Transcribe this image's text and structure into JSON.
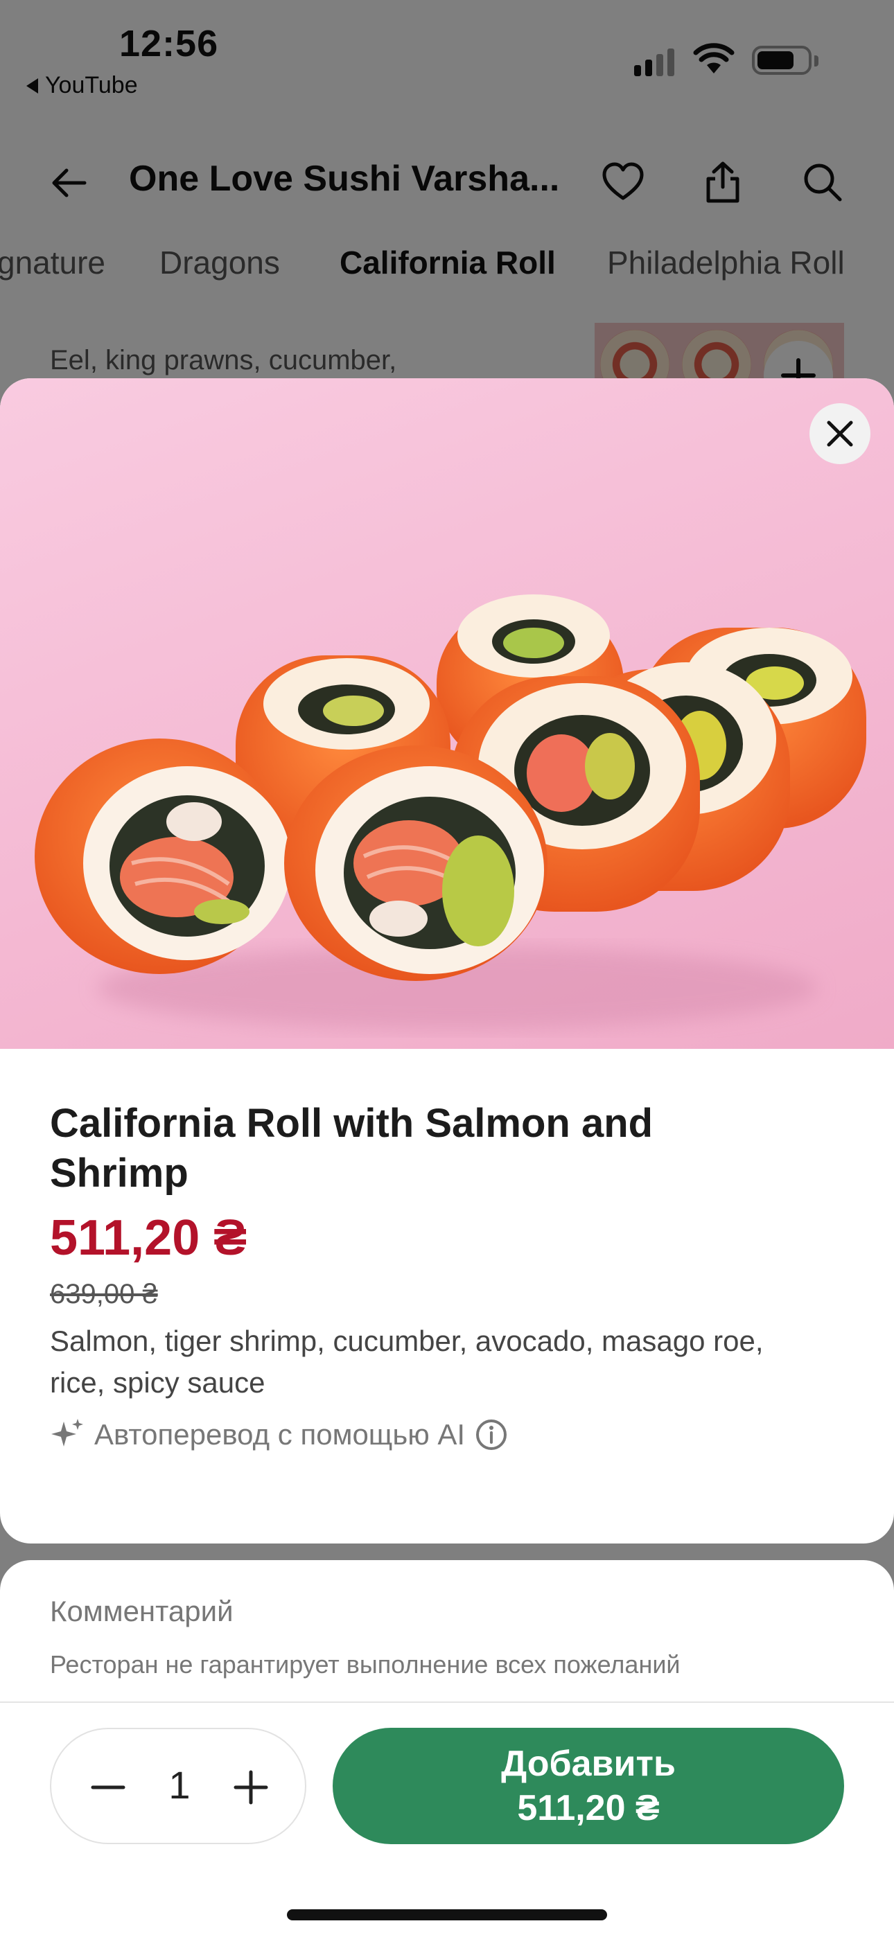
{
  "status_bar": {
    "time": "12:56",
    "back_app": "YouTube",
    "icons": [
      "cellular-signal-icon",
      "wifi-icon",
      "battery-icon"
    ]
  },
  "nav": {
    "title": "One Love Sushi Varsha...",
    "icons": [
      "back-arrow-icon",
      "heart-icon",
      "share-icon",
      "search-icon"
    ]
  },
  "category_tabs": [
    {
      "label": "gnature",
      "active": false
    },
    {
      "label": "Dragons",
      "active": false
    },
    {
      "label": "California Roll",
      "active": true
    },
    {
      "label": "Philadelphia Roll",
      "active": false
    }
  ],
  "background_item": {
    "description": "Eel, king prawns, cucumber,"
  },
  "product": {
    "title": "California Roll with Salmon and Shrimp",
    "price": "511,20 ₴",
    "old_price": "639,00 ₴",
    "description": "Salmon, tiger shrimp, cucumber, avocado, masago roe, rice, spicy sauce",
    "ai_note": "Автоперевод с помощью AI"
  },
  "comment": {
    "label": "Комментарий",
    "hint": "Ресторан не гарантирует выполнение всех пожеланий"
  },
  "order": {
    "quantity": "1",
    "add_label": "Добавить",
    "add_price": "511,20 ₴"
  },
  "colors": {
    "price": "#b3122a",
    "add_button": "#2e8a5b",
    "hero_background": "#f4b9d3",
    "masago": "#f26a2c"
  }
}
